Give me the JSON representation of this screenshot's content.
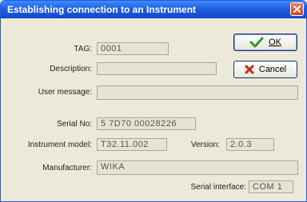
{
  "window": {
    "title": "Establishing connection to an Instrument"
  },
  "buttons": {
    "ok_label": "OK",
    "cancel_label": "Cancel"
  },
  "fields": {
    "tag": {
      "label": "TAG:",
      "value": "0001"
    },
    "description": {
      "label": "Description:",
      "value": ""
    },
    "user_message": {
      "label": "User message:",
      "value": ""
    },
    "serial_no": {
      "label": "Serial No:",
      "value": "5 7D70 00028226"
    },
    "instrument_model": {
      "label": "Instrument model:",
      "value": "T32.11.002"
    },
    "version": {
      "label": "Version:",
      "value": "2.0.3"
    },
    "manufacturer": {
      "label": "Manufacturer:",
      "value": "WIKA"
    },
    "serial_interface": {
      "label": "Serial interface:",
      "value": "COM 1"
    }
  },
  "colors": {
    "title_bar": "#1f5fe0",
    "ok_check": "#2e9a2a",
    "cancel_x": "#c0281e"
  }
}
